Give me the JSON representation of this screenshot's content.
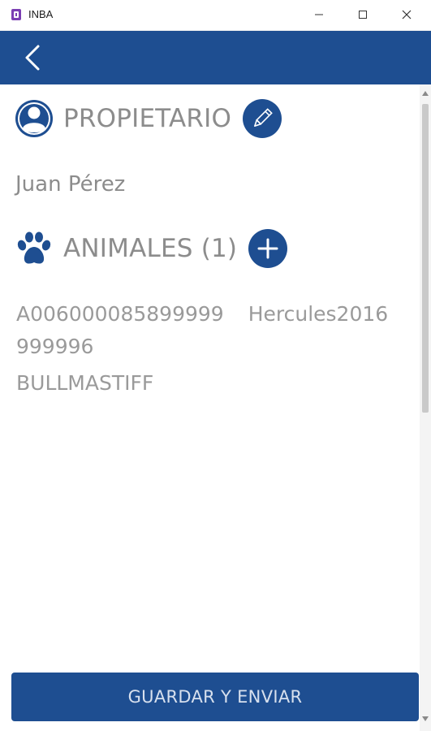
{
  "window": {
    "title": "INBA"
  },
  "owner_section": {
    "title": "PROPIETARIO",
    "name": "Juan Pérez",
    "icon": "user-icon",
    "edit_icon": "pencil-icon"
  },
  "animals_section": {
    "title": "ANIMALES",
    "count": "(1)",
    "icon": "paw-icon",
    "add_icon": "plus-icon",
    "items": [
      {
        "id": "A006000085899999",
        "name": "Hercules2016",
        "id_wrap": "999996",
        "breed": "BULLMASTIFF"
      }
    ]
  },
  "footer": {
    "submit_label": "GUARDAR Y ENVIAR"
  },
  "colors": {
    "primary": "#1e4e91",
    "text_muted": "#8c8c8c",
    "app_icon": "#7b3fb3"
  }
}
